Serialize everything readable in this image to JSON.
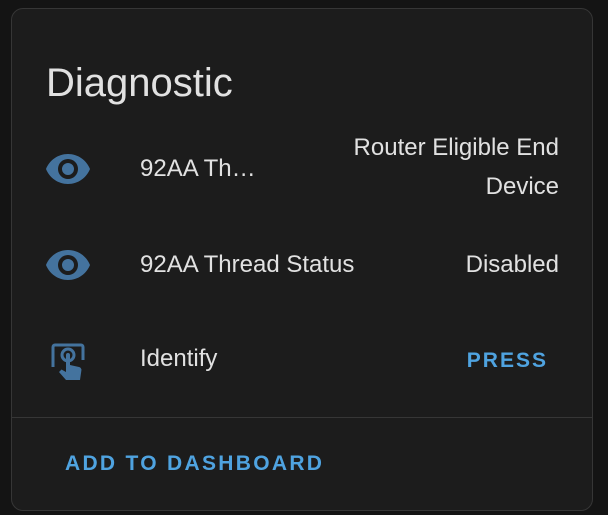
{
  "card": {
    "title": "Diagnostic",
    "rows": [
      {
        "icon": "eye-icon",
        "name": "92AA Th…",
        "value_line1": "Router Eligible End",
        "value_line2": "Device"
      },
      {
        "icon": "eye-icon",
        "name": "92AA Thread Status",
        "value": "Disabled"
      },
      {
        "icon": "gesture-tap-button-icon",
        "name": "Identify",
        "action_label": "PRESS"
      }
    ],
    "footer": {
      "add_to_dashboard_label": "ADD TO DASHBOARD"
    }
  },
  "colors": {
    "background": "#141414",
    "card": "#1c1c1c",
    "text": "#e1e1e1",
    "icon": "#44739e",
    "accent": "#4fa3e0",
    "divider": "#363636"
  }
}
